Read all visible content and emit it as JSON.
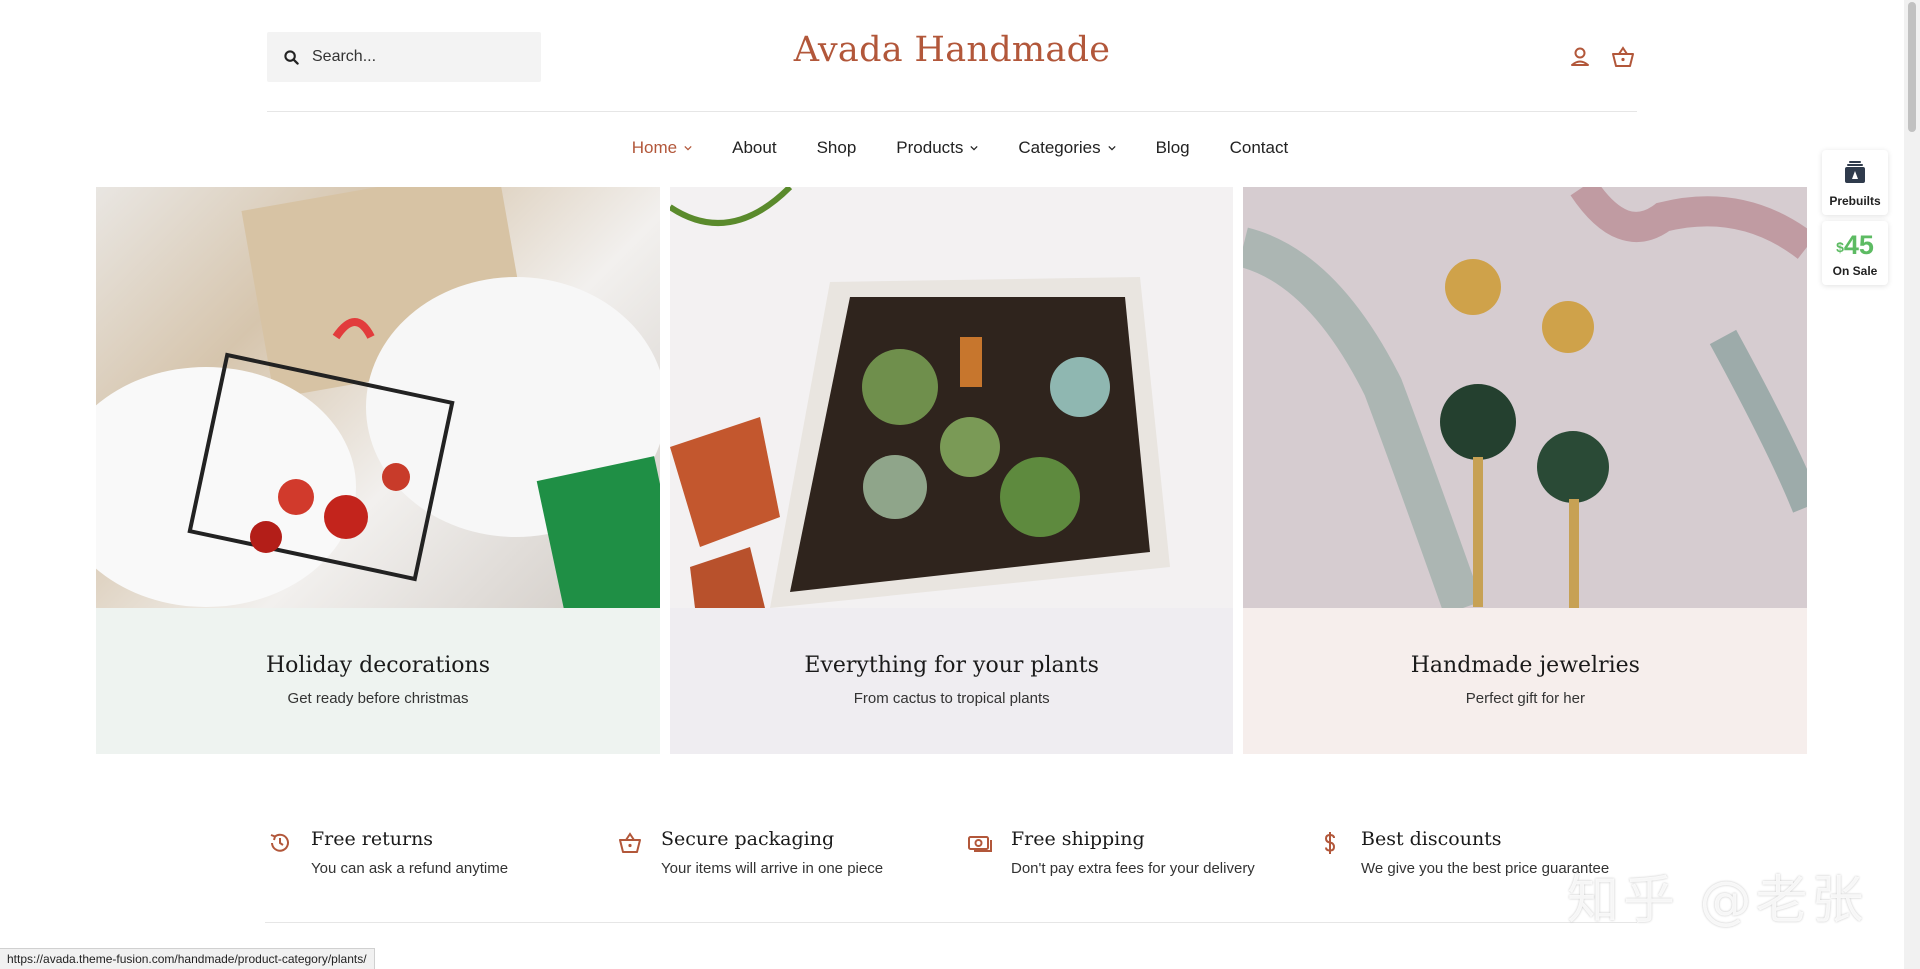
{
  "header": {
    "search_placeholder": "Search...",
    "logo_text": "Avada Handmade"
  },
  "nav": {
    "items": [
      {
        "label": "Home",
        "active": true,
        "has_dropdown": true
      },
      {
        "label": "About",
        "active": false,
        "has_dropdown": false
      },
      {
        "label": "Shop",
        "active": false,
        "has_dropdown": false
      },
      {
        "label": "Products",
        "active": false,
        "has_dropdown": true
      },
      {
        "label": "Categories",
        "active": false,
        "has_dropdown": true
      },
      {
        "label": "Blog",
        "active": false,
        "has_dropdown": false
      },
      {
        "label": "Contact",
        "active": false,
        "has_dropdown": false
      }
    ]
  },
  "side_widget": {
    "prebuilts_label": "Prebuilts",
    "price_currency": "$",
    "price_value": "45",
    "sale_label": "On Sale"
  },
  "cards": [
    {
      "title": "Holiday decorations",
      "subtitle": "Get ready before christmas"
    },
    {
      "title": "Everything for your plants",
      "subtitle": "From cactus to tropical plants"
    },
    {
      "title": "Handmade jewelries",
      "subtitle": "Perfect gift for her"
    }
  ],
  "features": [
    {
      "icon": "history-icon",
      "title": "Free returns",
      "subtitle": "You can ask a refund anytime"
    },
    {
      "icon": "basket-icon",
      "title": "Secure packaging",
      "subtitle": "Your items will arrive in one piece"
    },
    {
      "icon": "money-icon",
      "title": "Free shipping",
      "subtitle": "Don't pay extra fees for your delivery"
    },
    {
      "icon": "dollar-icon",
      "title": "Best discounts",
      "subtitle": "We give you the best price guarantee"
    }
  ],
  "watermark": "知乎 @老张",
  "status_bar_url": "https://avada.theme-fusion.com/handmade/product-category/plants/",
  "colors": {
    "accent": "#b2573a",
    "sale_green": "#5dbb63"
  }
}
